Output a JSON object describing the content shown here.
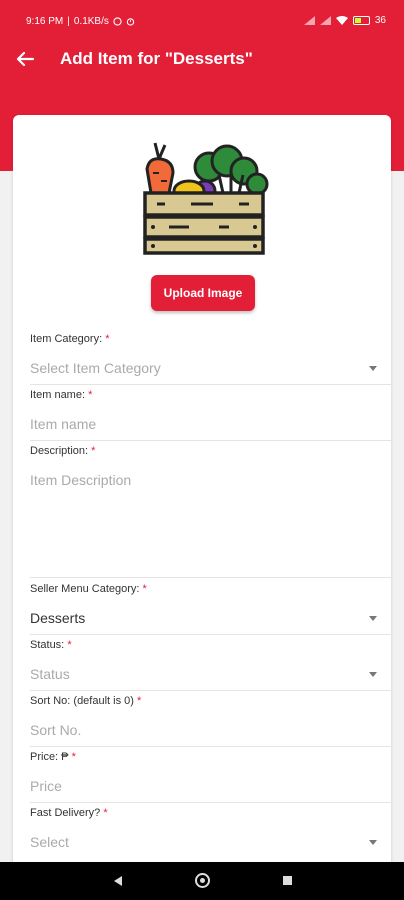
{
  "status_bar": {
    "time": "9:16 PM",
    "net_speed": "0.1KB/s",
    "battery": "36"
  },
  "header": {
    "title": "Add Item for \"Desserts\""
  },
  "upload": {
    "label": "Upload Image"
  },
  "form": {
    "item_category": {
      "label": "Item Category:",
      "required": "*",
      "placeholder": "Select Item Category"
    },
    "item_name": {
      "label": "Item name:",
      "required": "*",
      "placeholder": "Item name"
    },
    "description": {
      "label": "Description:",
      "required": "*",
      "placeholder": "Item Description"
    },
    "seller_menu_category": {
      "label": "Seller Menu Category:",
      "required": "*",
      "value": "Desserts"
    },
    "status": {
      "label": "Status:",
      "required": "*",
      "placeholder": "Status"
    },
    "sort_no": {
      "label": "Sort No: (default is 0)",
      "required": "*",
      "placeholder": "Sort No."
    },
    "price": {
      "label": "Price: ₱",
      "required": "*",
      "placeholder": "Price"
    },
    "fast_delivery": {
      "label": "Fast Delivery?",
      "required": "*",
      "placeholder": "Select"
    }
  },
  "colors": {
    "brand": "#e31e37"
  }
}
